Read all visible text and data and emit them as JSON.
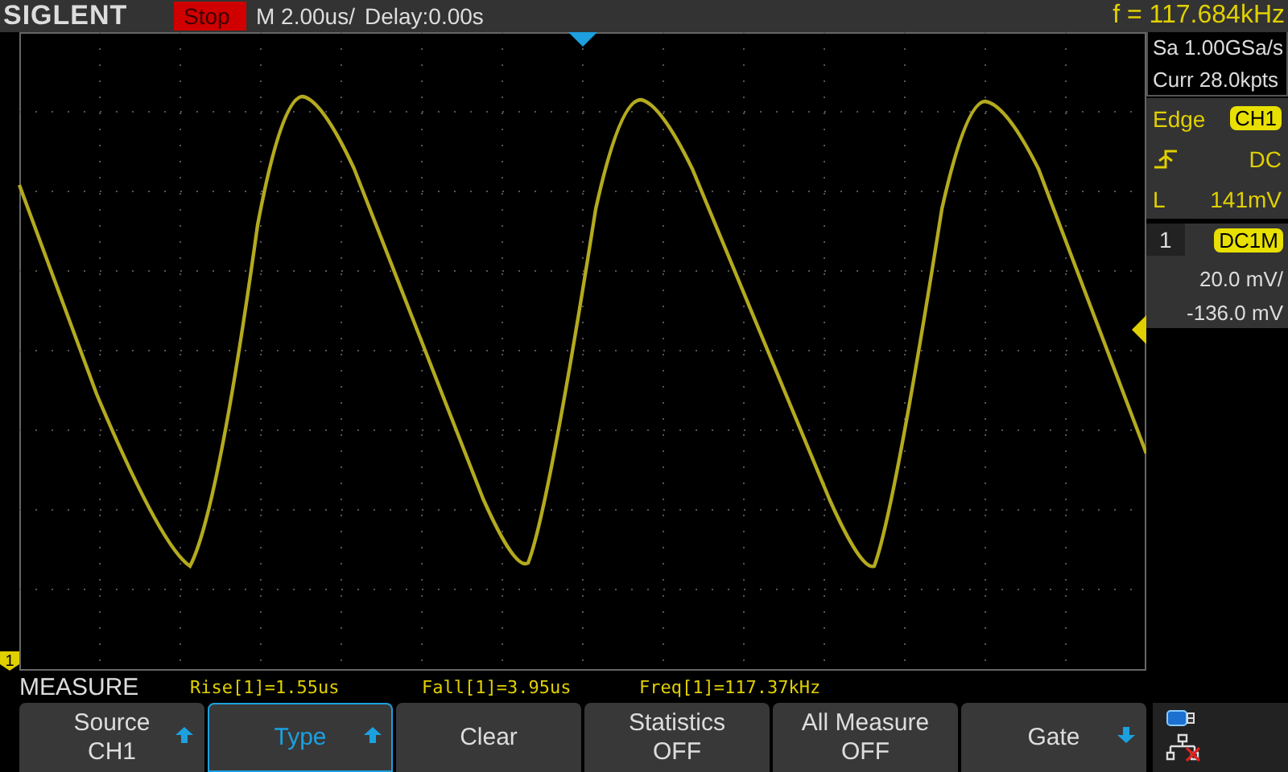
{
  "brand": "SIGLENT",
  "run_state": "Stop",
  "timebase": "M 2.00us/",
  "delay": "Delay:0.00s",
  "frequency": "f = 117.684kHz",
  "acquisition": {
    "sample_rate": "Sa 1.00GSa/s",
    "memory": "Curr 28.0kpts"
  },
  "trigger": {
    "type": "Edge",
    "source": "CH1",
    "kind": "rising",
    "coupling": "DC",
    "level_label": "L",
    "level_value": "141mV"
  },
  "channel": {
    "number": "1",
    "coupling": "DC1M",
    "scale": "20.0 mV/",
    "offset": "-136.0 mV"
  },
  "channel_marker": "1",
  "menu_title": "MEASURE",
  "measurements": [
    "Rise[1]=1.55us",
    "Fall[1]=3.95us",
    "Freq[1]=117.37kHz"
  ],
  "softkeys": [
    {
      "label": "Source",
      "value": "CH1",
      "kind": "up",
      "selected": false
    },
    {
      "label": "Type",
      "kind": "up",
      "selected": true
    },
    {
      "label": "Clear",
      "selected": false
    },
    {
      "label": "Statistics",
      "value": "OFF",
      "selected": false
    },
    {
      "label": "All Measure",
      "value": "OFF",
      "selected": false
    },
    {
      "label": "Gate",
      "kind": "down",
      "selected": false
    }
  ]
}
